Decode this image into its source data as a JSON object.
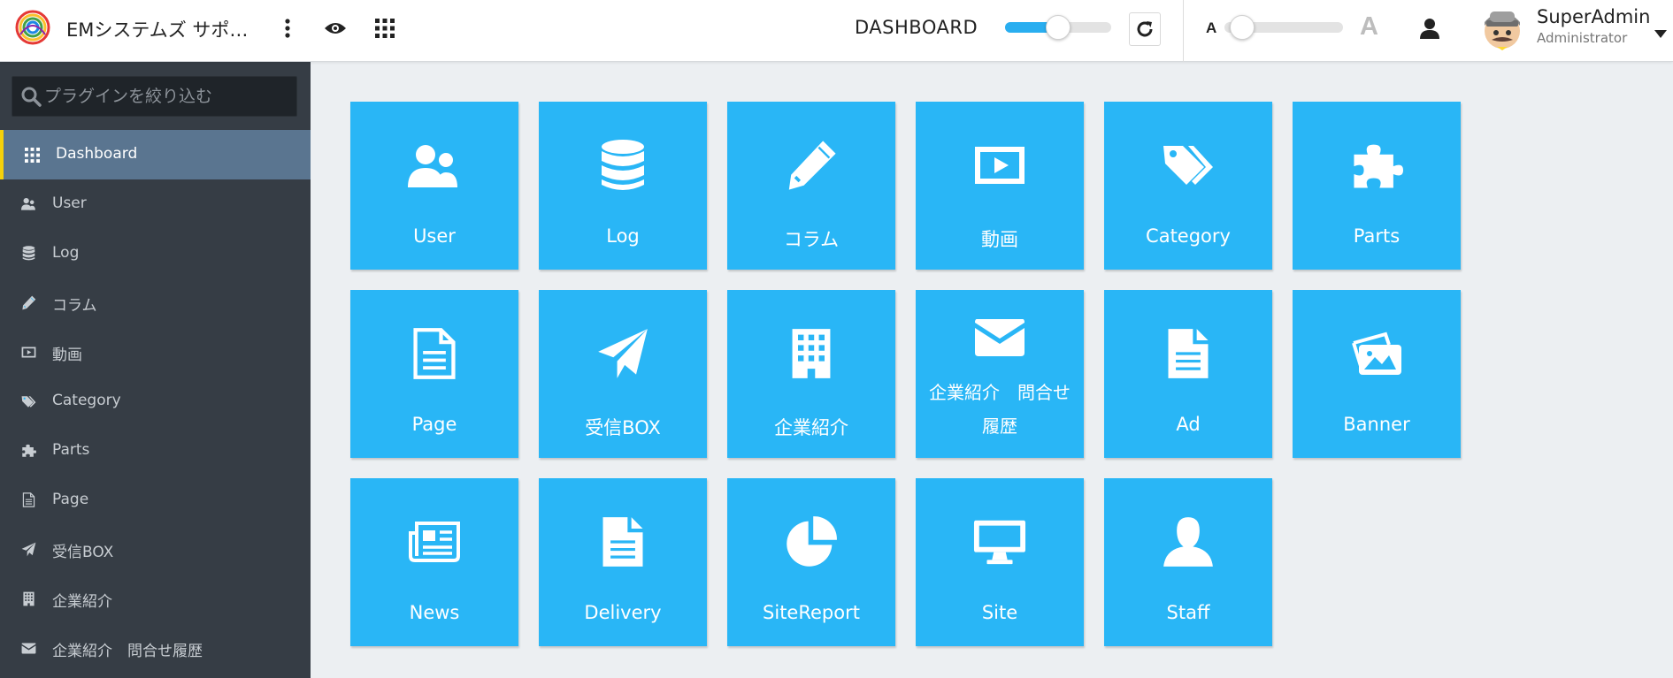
{
  "header": {
    "app_title": "EMシステムズ サポ…",
    "dashboard_label": "DASHBOARD",
    "font_size_small_label": "A",
    "font_size_large_label": "A",
    "zoom_slider_level": 0.5,
    "font_slider_level": 0.0,
    "user": {
      "name": "SuperAdmin",
      "role": "Administrator"
    },
    "icons": [
      "more-vertical-icon",
      "eye-icon",
      "apps-grid-icon",
      "refresh-icon",
      "user-icon",
      "caret-down-icon"
    ],
    "accent_color": "#29aef0"
  },
  "sidebar": {
    "search_placeholder": "プラグインを絞り込む",
    "background_color": "#363d45",
    "active_color": "#5a7590",
    "active_marker_color": "#f5d10b",
    "items": [
      {
        "label": "Dashboard",
        "icon": "grid-icon",
        "active": true
      },
      {
        "label": "User",
        "icon": "users-icon",
        "active": false
      },
      {
        "label": "Log",
        "icon": "database-icon",
        "active": false
      },
      {
        "label": "コラム",
        "icon": "pencil-icon",
        "active": false
      },
      {
        "label": "動画",
        "icon": "video-icon",
        "active": false
      },
      {
        "label": "Category",
        "icon": "tags-icon",
        "active": false
      },
      {
        "label": "Parts",
        "icon": "puzzle-icon",
        "active": false
      },
      {
        "label": "Page",
        "icon": "page-icon",
        "active": false
      },
      {
        "label": "受信BOX",
        "icon": "paper-plane-icon",
        "active": false
      },
      {
        "label": "企業紹介",
        "icon": "building-icon",
        "active": false
      },
      {
        "label": "企業紹介　問合せ履歴",
        "icon": "envelope-icon",
        "active": false
      }
    ]
  },
  "tiles": {
    "color": "#29b6f6",
    "items": [
      {
        "label": "User",
        "icon": "users-icon"
      },
      {
        "label": "Log",
        "icon": "database-icon"
      },
      {
        "label": "コラム",
        "icon": "pencil-icon"
      },
      {
        "label": "動画",
        "icon": "video-icon"
      },
      {
        "label": "Category",
        "icon": "tags-icon"
      },
      {
        "label": "Parts",
        "icon": "puzzle-icon"
      },
      {
        "label": "Page",
        "icon": "page-icon"
      },
      {
        "label": "受信BOX",
        "icon": "paper-plane-icon"
      },
      {
        "label": "企業紹介",
        "icon": "building-icon"
      },
      {
        "label": "企業紹介　問合せ",
        "label_line2": "履歴",
        "icon": "envelope-icon"
      },
      {
        "label": "Ad",
        "icon": "file-text-icon"
      },
      {
        "label": "Banner",
        "icon": "images-icon"
      },
      {
        "label": "News",
        "icon": "newspaper-icon"
      },
      {
        "label": "Delivery",
        "icon": "file-text-icon"
      },
      {
        "label": "SiteReport",
        "icon": "pie-chart-icon"
      },
      {
        "label": "Site",
        "icon": "monitor-icon"
      },
      {
        "label": "Staff",
        "icon": "user-icon"
      }
    ]
  }
}
